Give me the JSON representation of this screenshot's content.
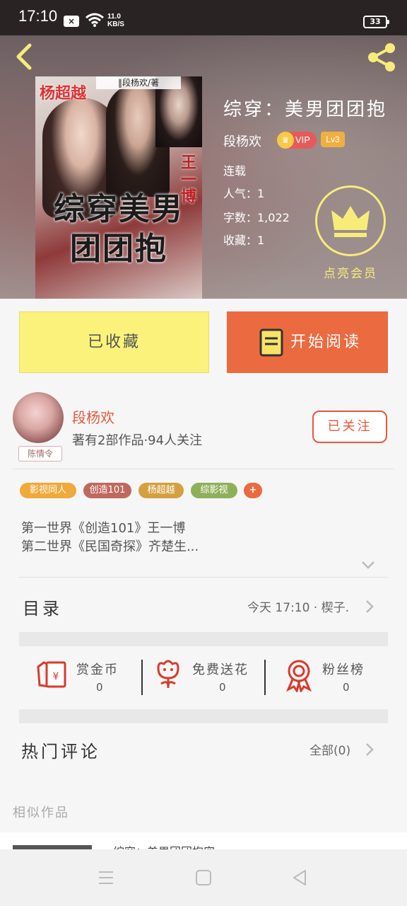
{
  "status_bar": {
    "time": "17:10",
    "speed_value": "11.0",
    "speed_unit": "KB/S",
    "battery": "33"
  },
  "book": {
    "title": "综穿：美男团团抱",
    "author": "段杨欢",
    "vip_label": "VIP",
    "level": "Lv3",
    "status": "连载",
    "popularity": "人气：1",
    "word_count": "字数：1,022",
    "favorites": "收藏：1",
    "member_label": "点亮会员",
    "cover": {
      "name_left": "杨超越",
      "author_strip": "‖段杨欢/著",
      "name_right": "王一博",
      "title_art": "综穿美男团团抱"
    }
  },
  "actions": {
    "favorited_label": "已收藏",
    "read_label": "开始阅读"
  },
  "author_card": {
    "name": "段杨欢",
    "stats": "著有2部作品·94人关注",
    "avatar_tag": "陈情令",
    "follow_label": "已关注"
  },
  "tags": [
    {
      "label": "影视同人",
      "color": "#f0a93b"
    },
    {
      "label": "创造101",
      "color": "#c0695f"
    },
    {
      "label": "杨超越",
      "color": "#d4a040"
    },
    {
      "label": "综影视",
      "color": "#8fb05a"
    },
    {
      "label": "+",
      "color": "#ec6a3f"
    }
  ],
  "description": {
    "line1": "第一世界《创造101》王一博",
    "line2": "第二世界《民国奇探》齐楚生..."
  },
  "catalog": {
    "label": "目录",
    "update": "今天 17:10 · 楔子."
  },
  "stats": [
    {
      "label": "赏金币",
      "value": "0",
      "icon": "red-envelope-icon"
    },
    {
      "label": "免费送花",
      "value": "0",
      "icon": "flower-icon"
    },
    {
      "label": "粉丝榜",
      "value": "0",
      "icon": "medal-icon"
    }
  ],
  "comments": {
    "label": "热门评论",
    "all": "全部(0)"
  },
  "similar": {
    "label": "相似作品",
    "peek_text": "综穿：美男团团抱宠"
  },
  "colors": {
    "accent": "#ec6a3f",
    "favorite_bg": "#fbf27c",
    "member_gold": "#f7ec7a"
  }
}
